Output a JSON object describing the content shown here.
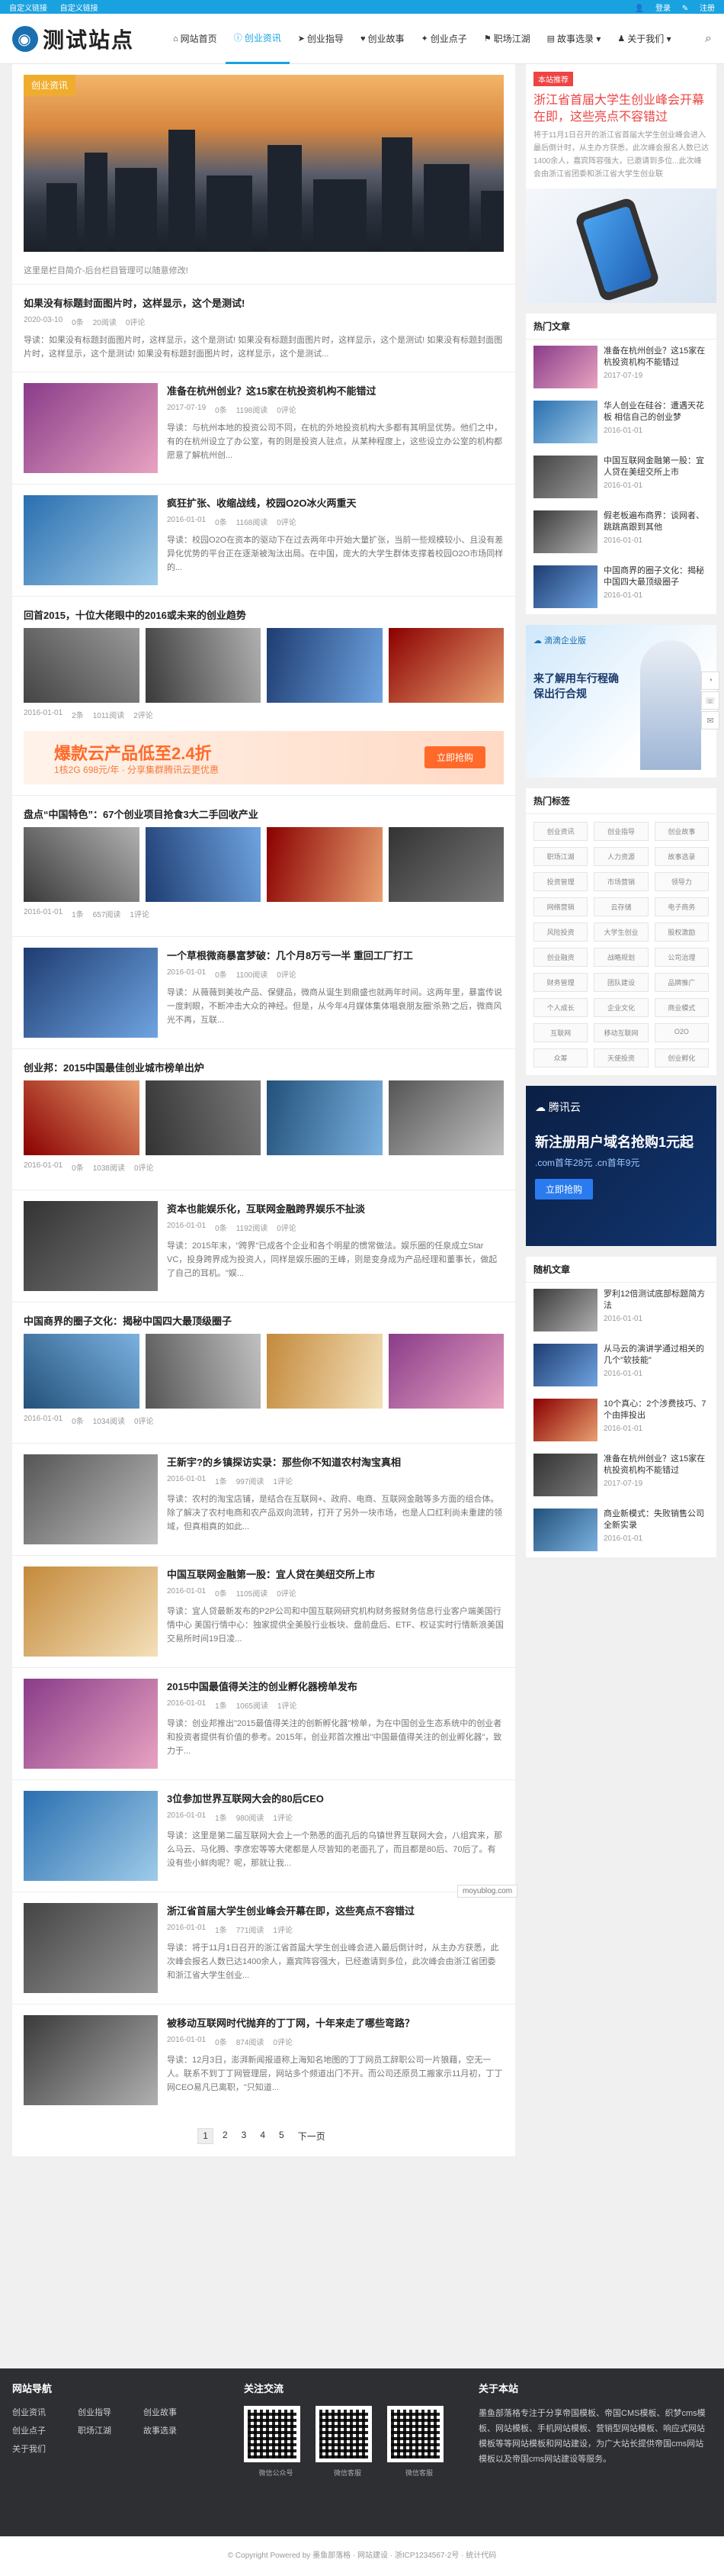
{
  "topbar": {
    "left": [
      "自定义链接",
      "自定义链接"
    ],
    "login": "登录",
    "register": "注册"
  },
  "site": {
    "logo_text": "测试站点"
  },
  "nav": [
    {
      "label": "网站首页",
      "icon": "home-icon"
    },
    {
      "label": "创业资讯",
      "icon": "info-icon",
      "active": true
    },
    {
      "label": "创业指导",
      "icon": "send-icon"
    },
    {
      "label": "创业故事",
      "icon": "heart-icon"
    },
    {
      "label": "创业点子",
      "icon": "bulb-icon"
    },
    {
      "label": "职场江湖",
      "icon": "flag-icon"
    },
    {
      "label": "故事选录 ▾",
      "icon": "book-icon"
    },
    {
      "label": "关于我们 ▾",
      "icon": "user-icon"
    }
  ],
  "hero": {
    "tag": "创业资讯",
    "caption": "这里是栏目简介-后台栏目管理可以随意修改!"
  },
  "posts": [
    {
      "kind": "text",
      "title": "如果没有标题封面图片时，这样显示，这个是测试!",
      "date": "2020-03-10",
      "cmt": "0条",
      "views": "20阅读",
      "likes": "0评论",
      "excerpt": "导读：如果没有标题封面图片时，这样显示，这个是测试! 如果没有标题封面图片时，这样显示，这个是测试! 如果没有标题封面图片时，这样显示，这个是测试! 如果没有标题封面图片时，这样显示，这个是测试..."
    },
    {
      "kind": "thumb",
      "title": "准备在杭州创业？这15家在杭投资机构不能错过",
      "date": "2017-07-19",
      "cmt": "0条",
      "views": "1198阅读",
      "likes": "0评论",
      "excerpt": "导读：与杭州本地的投资公司不同，在杭的外地投资机构大多都有其明显优势。他们之中，有的在杭州设立了办公室，有的则是投资人驻点，从某种程度上，这些设立办公室的机构都愿意了解杭州创..."
    },
    {
      "kind": "thumb",
      "title": "疯狂扩张、收缩战线，校园O2O冰火两重天",
      "date": "2016-01-01",
      "cmt": "0条",
      "views": "1168阅读",
      "likes": "0评论",
      "excerpt": "导读：校园O2O在资本的驱动下在过去两年中开始大量扩张，当前一些规模较小、且没有差异化优势的平台正在逐渐被淘汰出局。在中国，庞大的大学生群体支撑着校园O2O市场同样的..."
    },
    {
      "kind": "grid",
      "title": "回首2015，十位大佬眼中的2016或未来的创业趋势",
      "date": "2016-01-01",
      "cmt": "2条",
      "views": "1011阅读",
      "likes": "2评论"
    },
    {
      "kind": "grid",
      "title": "盘点“中国特色”：67个创业项目抢食3大二手回收产业",
      "date": "2016-01-01",
      "cmt": "1条",
      "views": "657阅读",
      "likes": "1评论"
    },
    {
      "kind": "thumb",
      "title": "一个草根微商暴富梦破：几个月8万亏一半 重回工厂打工",
      "date": "2016-01-01",
      "cmt": "0条",
      "views": "1100阅读",
      "likes": "0评论",
      "excerpt": "导读：从薇薇到美妆产品、保健品，微商从诞生到鼎盛也就两年时间。这两年里，暴富传说一度刺眼，不断冲击大众的神经。但是，从今年4月媒体集体唱衰朋友圈'杀熟'之后，微商风光不再，互联..."
    },
    {
      "kind": "grid",
      "title": "创业邦：2015中国最佳创业城市榜单出炉",
      "date": "2016-01-01",
      "cmt": "0条",
      "views": "1038阅读",
      "likes": "0评论"
    },
    {
      "kind": "thumb",
      "title": "资本也能娱乐化，互联网金融跨界娱乐不扯淡",
      "date": "2016-01-01",
      "cmt": "0条",
      "views": "1192阅读",
      "likes": "0评论",
      "excerpt": "导读：2015年末，\"跨界\"已成各个企业和各个明星的惯常做法。娱乐圈的任泉成立Star VC，投身跨界成为投资人，同样是娱乐圈的王峰，则是变身成为产品经理和董事长，做起了自己的耳机。\"娱..."
    },
    {
      "kind": "grid",
      "title": "中国商界的圈子文化：揭秘中国四大最顶级圈子",
      "date": "2016-01-01",
      "cmt": "0条",
      "views": "1034阅读",
      "likes": "0评论"
    },
    {
      "kind": "thumb",
      "title": "王新宇?的乡镇探访实录：那些你不知道农村淘宝真相",
      "date": "2016-01-01",
      "cmt": "1条",
      "views": "997阅读",
      "likes": "1评论",
      "excerpt": "导读：农村的淘宝店铺，是结合在互联网+、政府、电商、互联网金融等多方面的组合体。除了解决了农村电商和农产品双向流转，打开了另外一块市场，也是人口红利尚未重建的领域，但真相真的如此..."
    },
    {
      "kind": "thumb",
      "title": "中国互联网金融第一股：宜人贷在美纽交所上市",
      "date": "2016-01-01",
      "cmt": "0条",
      "views": "1105阅读",
      "likes": "0评论",
      "excerpt": "导读：宜人贷最新发布的P2P公司和中国互联网研究机构财务报财务信息行业客户端美国行情中心 美国行情中心：独家提供全美股行业板块、盘前盘后、ETF、权证实时行情新浪美国交易所时间19日凌..."
    },
    {
      "kind": "thumb",
      "title": "2015中国最值得关注的创业孵化器榜单发布",
      "date": "2016-01-01",
      "cmt": "1条",
      "views": "1065阅读",
      "likes": "1评论",
      "excerpt": "导读：创业邦推出\"2015最值得关注的创新孵化器\"榜单，为在中国创业生态系统中的创业者和投资者提供有价值的参考。2015年，创业邦首次推出\"中国最值得关注的创业孵化器\"，致力于..."
    },
    {
      "kind": "thumb",
      "title": "3位参加世界互联网大会的80后CEO",
      "date": "2016-01-01",
      "cmt": "1条",
      "views": "980阅读",
      "likes": "1评论",
      "excerpt": "导读：这里是第二届互联网大会上一个熟悉的面孔后的乌镇世界互联网大会，八组宾来，那么马云、马化腾、李彦宏等等大佬都是人尽皆知的老面孔了，而且都是80后、70后了。有没有些小鲜肉呢？呢，那就让我..."
    },
    {
      "kind": "thumb",
      "title": "浙江省首届大学生创业峰会开幕在即，这些亮点不容错过",
      "date": "2016-01-01",
      "cmt": "1条",
      "views": "771阅读",
      "likes": "1评论",
      "excerpt": "导读：将于11月1日召开的浙江省首届大学生创业峰会进入最后倒计时，从主办方获悉，此次峰会报名人数已达1400余人，嘉宾阵容强大，已经邀请到多位，此次峰会由浙江省团委和浙江省大学生创业..."
    },
    {
      "kind": "thumb",
      "title": "被移动互联网时代抛弃的丁丁网，十年来走了哪些弯路？",
      "date": "2016-01-01",
      "cmt": "0条",
      "views": "874阅读",
      "likes": "0评论",
      "excerpt": "导读：12月3日，澎湃新闻报道称上海知名地图的丁丁网员工辞职公司一片狼藉，空无一人。联系不到丁丁网管理层，网站多个频道出门不开。而公司还原员工搬家示11月初，丁丁网CEO易凡已离职，\"只知道..."
    }
  ],
  "banner": {
    "title": "爆款云产品低至2.4折",
    "sub": "1核2G 698元/年 · 分享集群腾讯云更优惠",
    "btn": "立即抢购"
  },
  "pager": [
    "1",
    "2",
    "3",
    "4",
    "5",
    "下一页"
  ],
  "side": {
    "rec_tag": "本站推荐",
    "rec_title": "浙江省首届大学生创业峰会开幕在即，这些亮点不容错过",
    "rec_desc": "将于11月1日召开的浙江省首届大学生创业峰会进入最后倒计时，从主办方获悉，此次峰会报名人数已达1400余人，嘉宾阵容强大，已邀请到多位...此次峰会由浙江省团委和浙江省大学生创业联",
    "hot_title": "热门文章",
    "hot": [
      {
        "t": "准备在杭州创业？这15家在杭投资机构不能错过",
        "d": "2017-07-19"
      },
      {
        "t": "华人创业在硅谷：遭遇天花板 相信自己的创业梦",
        "d": "2016-01-01"
      },
      {
        "t": "中国互联网金融第一股：宜人贷在美纽交所上市",
        "d": "2016-01-01"
      },
      {
        "t": "假老板遍布商界：谈网者、跳跳高跟到其他",
        "d": "2016-01-01"
      },
      {
        "t": "中国商界的圈子文化：揭秘中国四大最顶级圈子",
        "d": "2016-01-01"
      }
    ],
    "ad2_title": "来了解用车行程确保出行合规",
    "tags_title": "热门标签",
    "tags": [
      "创业资讯",
      "创业指导",
      "创业故事",
      "职场江湖",
      "人力资源",
      "故事选录",
      "投资管理",
      "市场营销",
      "领导力",
      "网络营销",
      "云存储",
      "电子商务",
      "风险投资",
      "大学生创业",
      "股权激励",
      "创业融资",
      "战略规划",
      "公司治理",
      "财务管理",
      "团队建设",
      "品牌推广",
      "个人成长",
      "企业文化",
      "商业模式",
      "互联网",
      "移动互联网",
      "O2O",
      "众筹",
      "天使投资",
      "创业孵化"
    ],
    "ad3_brand": "腾讯云",
    "ad3_title": "新注册用户域名抢购1元起",
    "ad3_sub": ".com首年28元 .cn首年9元",
    "ad3_btn": "立即抢购",
    "rand_title": "随机文章",
    "rand": [
      {
        "t": "罗利12倍测试底部标题简方法",
        "d": "2016-01-01"
      },
      {
        "t": "从马云的演讲学通过相关的几个\"软技能\"",
        "d": "2016-01-01"
      },
      {
        "t": "10个真心：2个涉费技巧、7个由摔投出",
        "d": "2016-01-01"
      },
      {
        "t": "准备在杭州创业？这15家在杭投资机构不能错过",
        "d": "2017-07-19"
      },
      {
        "t": "商业新模式：失败销售公司全新实录",
        "d": "2016-01-01"
      }
    ]
  },
  "footer": {
    "nav_title": "网站导航",
    "nav": [
      "创业资讯",
      "创业指导",
      "创业故事",
      "创业点子",
      "职场江湖",
      "故事选录",
      "关于我们"
    ],
    "follow_title": "关注交流",
    "qr": [
      "微信公众号",
      "微信客服",
      "微信客服"
    ],
    "about_title": "关于本站",
    "about": "墨鱼部落格专注于分享帝国模板、帝国CMS模板、织梦cms模板、网站模板、手机网站模板、营销型网站模板、响应式网站模板等等网站模板和网站建设，为广大站长提供帝国cms网站模板以及帝国cms网站建设等服务。",
    "copyright": "© Copyright Powered by 墨鱼部落格 · 网站建设 · 浙ICP1234567-2号 · 统计代码"
  },
  "watermark": "moyublog.com"
}
